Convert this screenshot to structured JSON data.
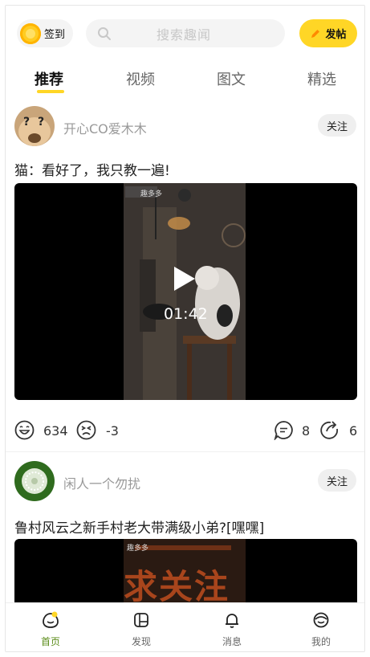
{
  "header": {
    "signin_label": "签到",
    "search_placeholder": "搜索趣闻",
    "post_label": "发帖"
  },
  "tabs": [
    {
      "label": "推荐",
      "active": true
    },
    {
      "label": "视频",
      "active": false
    },
    {
      "label": "图文",
      "active": false
    },
    {
      "label": "精选",
      "active": false
    }
  ],
  "posts": [
    {
      "username": "开心CO爱木木",
      "follow_label": "关注",
      "text": "猫：看好了，我只教一遍!",
      "video": {
        "duration": "01:42",
        "watermark": "趣多多"
      },
      "likes": "634",
      "dislikes": "-3",
      "comments": "8",
      "shares": "6"
    },
    {
      "username": "闲人一个勿扰",
      "follow_label": "关注",
      "text": "鲁村风云之新手村老大带满级小弟?[嘿嘿]",
      "video": {
        "overlay_text": "求关注",
        "watermark": "趣多多"
      }
    }
  ],
  "bottom_nav": [
    {
      "label": "首页",
      "icon": "home-icon",
      "active": true
    },
    {
      "label": "发现",
      "icon": "discover-icon",
      "active": false
    },
    {
      "label": "消息",
      "icon": "bell-icon",
      "active": false
    },
    {
      "label": "我的",
      "icon": "profile-icon",
      "active": false
    }
  ],
  "colors": {
    "accent": "#ffd626",
    "active_nav": "#5b8c1a"
  }
}
